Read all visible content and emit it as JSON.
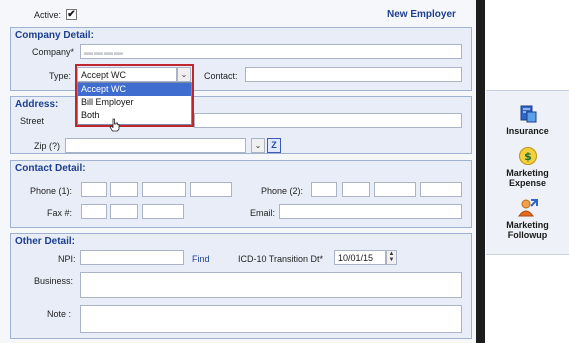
{
  "header": {
    "active_label": "Active:",
    "active_checked": "✔",
    "mode_label": "New Employer"
  },
  "company": {
    "title": "Company Detail:",
    "company_label": "Company*",
    "type_label": "Type:",
    "type_value": "Accept WC",
    "contact_label": "Contact:",
    "type_options": [
      "Accept WC",
      "Bill Employer",
      "Both"
    ]
  },
  "address": {
    "title": "Address:",
    "street_label": "Street",
    "zip_label": "Zip (?)"
  },
  "contact": {
    "title": "Contact Detail:",
    "phone1_label": "Phone (1):",
    "phone2_label": "Phone (2):",
    "fax_label": "Fax #:",
    "email_label": "Email:"
  },
  "other": {
    "title": "Other Detail:",
    "npi_label": "NPI:",
    "find_label": "Find",
    "icd_label": "ICD-10 Transition Dt*",
    "icd_value": "10/01/15",
    "business_label": "Business:",
    "note_label": "Note :"
  },
  "sidebar": {
    "items": [
      {
        "label_line1": "Insurance",
        "label_line2": "",
        "icon": "insurance-icon"
      },
      {
        "label_line1": "Marketing",
        "label_line2": "Expense",
        "icon": "dollar-icon"
      },
      {
        "label_line1": "Marketing",
        "label_line2": "Followup",
        "icon": "user-followup-icon"
      }
    ]
  },
  "colors": {
    "accent": "#1d3f8f",
    "highlight_border": "#c0272d",
    "selected_option": "#3f6ccf"
  }
}
